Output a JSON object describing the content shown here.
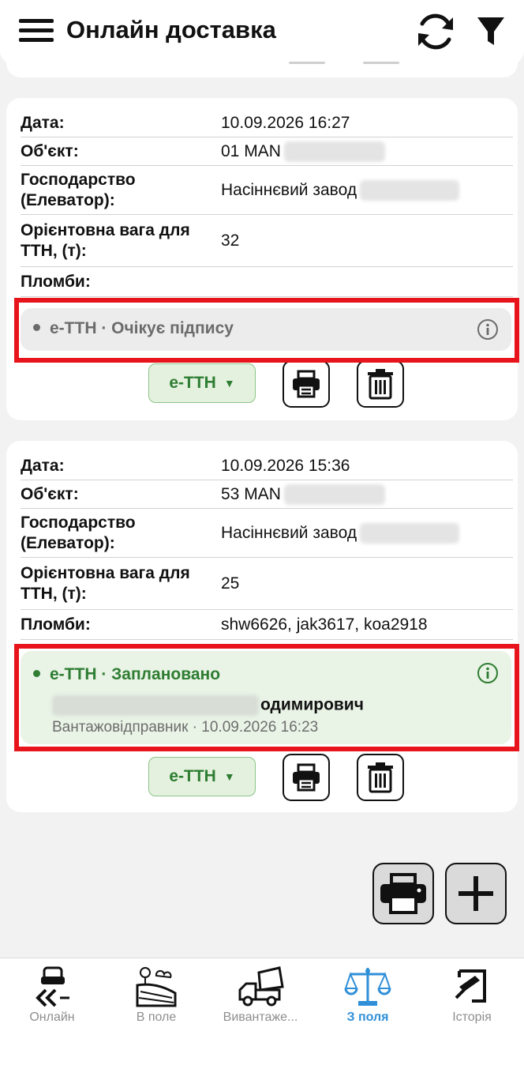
{
  "header": {
    "title": "Онлайн доставка",
    "menu_icon": "hamburger-menu-icon",
    "refresh_icon": "refresh-icon",
    "filter_icon": "filter-icon"
  },
  "cards": [
    {
      "fields": [
        {
          "label": "Дата:",
          "value": "10.09.2026 16:27"
        },
        {
          "label": "Об'єкт:",
          "value": "01 MAN"
        },
        {
          "label": "Господарство (Елеватор):",
          "value": "Насіннєвий завод"
        },
        {
          "label": "Орієнтовна вага для ТТН, (т):",
          "value": "32"
        },
        {
          "label": "Пломби:",
          "value": ""
        }
      ],
      "status": {
        "text": "е-ТТН · Очікує підпису",
        "color": "#6b6b6b"
      },
      "ettn_button": "е-ТТН"
    },
    {
      "fields": [
        {
          "label": "Дата:",
          "value": "10.09.2026 15:36"
        },
        {
          "label": "Об'єкт:",
          "value": "53 MAN"
        },
        {
          "label": "Господарство (Елеватор):",
          "value": "Насіннєвий завод"
        },
        {
          "label": "Орієнтовна вага для ТТН, (т):",
          "value": "25"
        },
        {
          "label": "Пломби:",
          "value": "shw6626, jak3617, koa2918"
        }
      ],
      "status": {
        "text": "е-ТТН · Заплановано",
        "color": "#2e7d32",
        "person": "одимирович",
        "meta": "Вантажовідправник · 10.09.2026 16:23"
      },
      "ettn_button": "е-ТТН"
    }
  ],
  "labels_split": {
    "farm_line1": "Господарство",
    "farm_line2": "(Елеватор):",
    "weight_line1": "Орієнтовна вага для",
    "weight_line2": "ТТН, (т):"
  },
  "fab": {
    "print_icon": "printer-icon",
    "add_icon": "plus-icon"
  },
  "bottom_nav": [
    {
      "label": "Онлайн",
      "icon": "road-car-icon",
      "active": false
    },
    {
      "label": "В поле",
      "icon": "field-icon",
      "active": false
    },
    {
      "label": "Вивантаже...",
      "icon": "dump-truck-icon",
      "active": false
    },
    {
      "label": "З поля",
      "icon": "scales-icon",
      "active": true
    },
    {
      "label": "Історія",
      "icon": "history-icon",
      "active": false
    }
  ],
  "colors": {
    "accent_green": "#2e7d32",
    "active_nav": "#2f8fd8",
    "highlight_red": "#e8141b"
  }
}
